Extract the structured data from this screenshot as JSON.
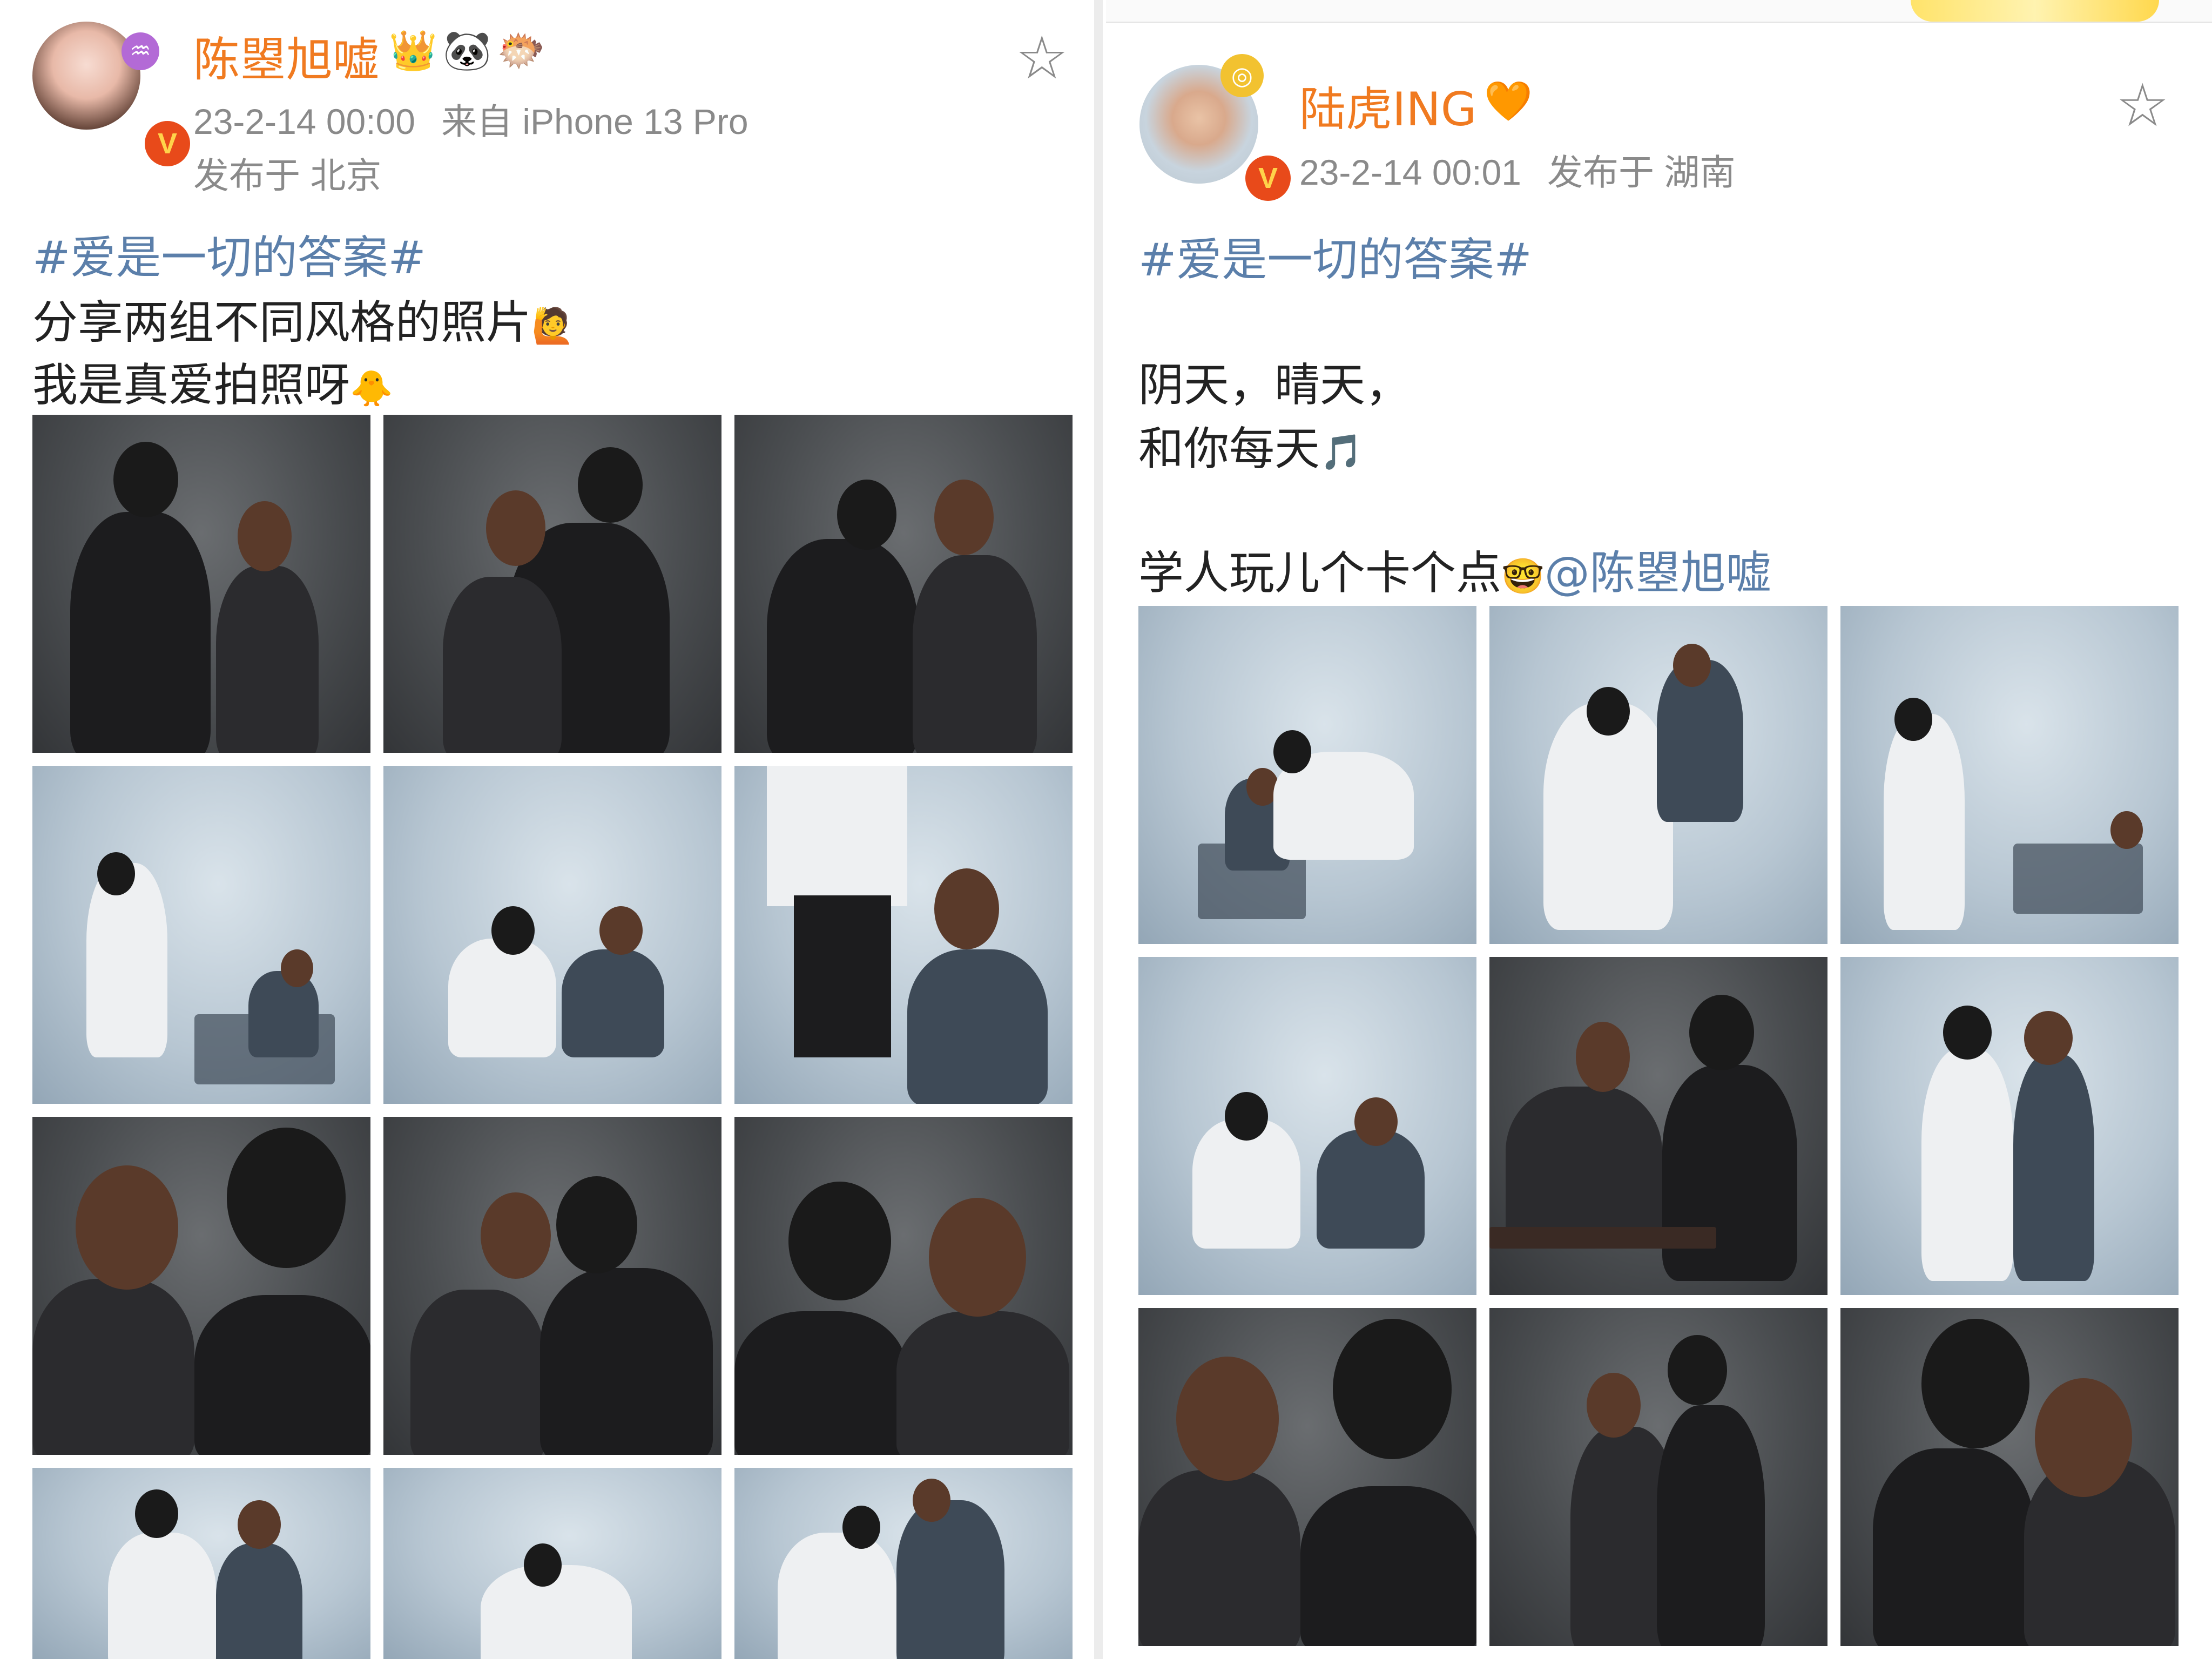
{
  "left_post": {
    "username": "陈曌旭嘘",
    "badges": [
      "crown-badge",
      "panda-badge",
      "fish-badge"
    ],
    "timestamp": "23-2-14 00:00",
    "source": "来自 iPhone 13 Pro",
    "location": "发布于 北京",
    "hashtag": "#爱是一切的答案#",
    "lines": [
      "分享两组不同风格的照片",
      "我是真爱拍照呀"
    ],
    "line_emojis": [
      "🙋",
      "🐥"
    ],
    "photos": [
      "dark",
      "dark",
      "dark",
      "light",
      "light",
      "light",
      "dark",
      "dark",
      "dark",
      "light",
      "light",
      "light"
    ]
  },
  "right_post": {
    "username": "陆虎ING",
    "badges": [
      "heart-badge"
    ],
    "timestamp": "23-2-14 00:01",
    "location": "发布于 湖南",
    "hashtag": "#爱是一切的答案#",
    "lines": [
      "阴天，晴天，",
      "和你每天"
    ],
    "line_emoji": "🎵",
    "extra_line": "学人玩儿个卡个点",
    "extra_emoji": "🤓",
    "mention": "@陈曌旭嘘",
    "photos": [
      "light",
      "light",
      "light",
      "light",
      "dark",
      "light",
      "dark",
      "dark",
      "dark"
    ]
  },
  "icons": {
    "verified": "V",
    "star": "☆"
  },
  "colors": {
    "username": "#f07a20",
    "link": "#5b7faa",
    "meta": "#8a8a8a",
    "verified": "#e84a1a"
  }
}
